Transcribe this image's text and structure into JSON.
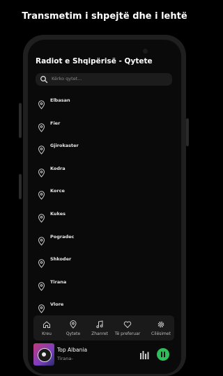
{
  "banner": "Transmetim i shpejtë dhe i lehtë",
  "header": {
    "title": "Radiot e Shqipërisë - Qytete"
  },
  "search": {
    "placeholder": "Kërko qytet..."
  },
  "cities": [
    "Elbasan",
    "Fier",
    "Gjirokaster",
    "Kodra",
    "Korce",
    "Kukes",
    "Pogradec",
    "Shkoder",
    "Tirana",
    "Vlore"
  ],
  "nav": [
    {
      "label": "Kreu",
      "icon": "home-icon"
    },
    {
      "label": "Qytete",
      "icon": "location-pin-icon"
    },
    {
      "label": "Zhanret",
      "icon": "music-note-icon"
    },
    {
      "label": "Të preferuar",
      "icon": "heart-icon"
    },
    {
      "label": "Cilësimet",
      "icon": "gear-icon"
    }
  ],
  "player": {
    "title": "Top Albania",
    "subtitle": "Tirana-",
    "accent": "#2fbf5a"
  }
}
